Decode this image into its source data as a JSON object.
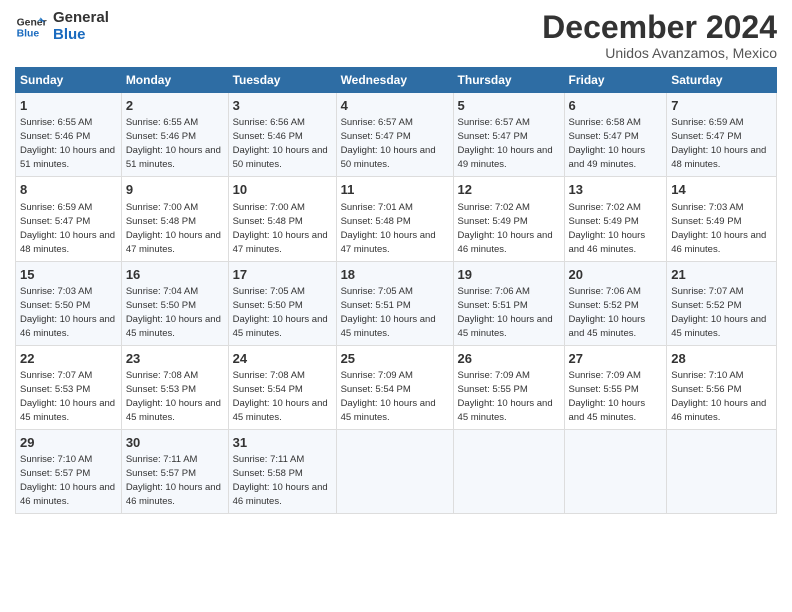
{
  "logo": {
    "line1": "General",
    "line2": "Blue"
  },
  "title": "December 2024",
  "subtitle": "Unidos Avanzamos, Mexico",
  "days_of_week": [
    "Sunday",
    "Monday",
    "Tuesday",
    "Wednesday",
    "Thursday",
    "Friday",
    "Saturday"
  ],
  "weeks": [
    [
      {
        "day": "1",
        "sunrise": "6:55 AM",
        "sunset": "5:46 PM",
        "daylight": "10 hours and 51 minutes."
      },
      {
        "day": "2",
        "sunrise": "6:55 AM",
        "sunset": "5:46 PM",
        "daylight": "10 hours and 51 minutes."
      },
      {
        "day": "3",
        "sunrise": "6:56 AM",
        "sunset": "5:46 PM",
        "daylight": "10 hours and 50 minutes."
      },
      {
        "day": "4",
        "sunrise": "6:57 AM",
        "sunset": "5:47 PM",
        "daylight": "10 hours and 50 minutes."
      },
      {
        "day": "5",
        "sunrise": "6:57 AM",
        "sunset": "5:47 PM",
        "daylight": "10 hours and 49 minutes."
      },
      {
        "day": "6",
        "sunrise": "6:58 AM",
        "sunset": "5:47 PM",
        "daylight": "10 hours and 49 minutes."
      },
      {
        "day": "7",
        "sunrise": "6:59 AM",
        "sunset": "5:47 PM",
        "daylight": "10 hours and 48 minutes."
      }
    ],
    [
      {
        "day": "8",
        "sunrise": "6:59 AM",
        "sunset": "5:47 PM",
        "daylight": "10 hours and 48 minutes."
      },
      {
        "day": "9",
        "sunrise": "7:00 AM",
        "sunset": "5:48 PM",
        "daylight": "10 hours and 47 minutes."
      },
      {
        "day": "10",
        "sunrise": "7:00 AM",
        "sunset": "5:48 PM",
        "daylight": "10 hours and 47 minutes."
      },
      {
        "day": "11",
        "sunrise": "7:01 AM",
        "sunset": "5:48 PM",
        "daylight": "10 hours and 47 minutes."
      },
      {
        "day": "12",
        "sunrise": "7:02 AM",
        "sunset": "5:49 PM",
        "daylight": "10 hours and 46 minutes."
      },
      {
        "day": "13",
        "sunrise": "7:02 AM",
        "sunset": "5:49 PM",
        "daylight": "10 hours and 46 minutes."
      },
      {
        "day": "14",
        "sunrise": "7:03 AM",
        "sunset": "5:49 PM",
        "daylight": "10 hours and 46 minutes."
      }
    ],
    [
      {
        "day": "15",
        "sunrise": "7:03 AM",
        "sunset": "5:50 PM",
        "daylight": "10 hours and 46 minutes."
      },
      {
        "day": "16",
        "sunrise": "7:04 AM",
        "sunset": "5:50 PM",
        "daylight": "10 hours and 45 minutes."
      },
      {
        "day": "17",
        "sunrise": "7:05 AM",
        "sunset": "5:50 PM",
        "daylight": "10 hours and 45 minutes."
      },
      {
        "day": "18",
        "sunrise": "7:05 AM",
        "sunset": "5:51 PM",
        "daylight": "10 hours and 45 minutes."
      },
      {
        "day": "19",
        "sunrise": "7:06 AM",
        "sunset": "5:51 PM",
        "daylight": "10 hours and 45 minutes."
      },
      {
        "day": "20",
        "sunrise": "7:06 AM",
        "sunset": "5:52 PM",
        "daylight": "10 hours and 45 minutes."
      },
      {
        "day": "21",
        "sunrise": "7:07 AM",
        "sunset": "5:52 PM",
        "daylight": "10 hours and 45 minutes."
      }
    ],
    [
      {
        "day": "22",
        "sunrise": "7:07 AM",
        "sunset": "5:53 PM",
        "daylight": "10 hours and 45 minutes."
      },
      {
        "day": "23",
        "sunrise": "7:08 AM",
        "sunset": "5:53 PM",
        "daylight": "10 hours and 45 minutes."
      },
      {
        "day": "24",
        "sunrise": "7:08 AM",
        "sunset": "5:54 PM",
        "daylight": "10 hours and 45 minutes."
      },
      {
        "day": "25",
        "sunrise": "7:09 AM",
        "sunset": "5:54 PM",
        "daylight": "10 hours and 45 minutes."
      },
      {
        "day": "26",
        "sunrise": "7:09 AM",
        "sunset": "5:55 PM",
        "daylight": "10 hours and 45 minutes."
      },
      {
        "day": "27",
        "sunrise": "7:09 AM",
        "sunset": "5:55 PM",
        "daylight": "10 hours and 45 minutes."
      },
      {
        "day": "28",
        "sunrise": "7:10 AM",
        "sunset": "5:56 PM",
        "daylight": "10 hours and 46 minutes."
      }
    ],
    [
      {
        "day": "29",
        "sunrise": "7:10 AM",
        "sunset": "5:57 PM",
        "daylight": "10 hours and 46 minutes."
      },
      {
        "day": "30",
        "sunrise": "7:11 AM",
        "sunset": "5:57 PM",
        "daylight": "10 hours and 46 minutes."
      },
      {
        "day": "31",
        "sunrise": "7:11 AM",
        "sunset": "5:58 PM",
        "daylight": "10 hours and 46 minutes."
      },
      null,
      null,
      null,
      null
    ]
  ]
}
